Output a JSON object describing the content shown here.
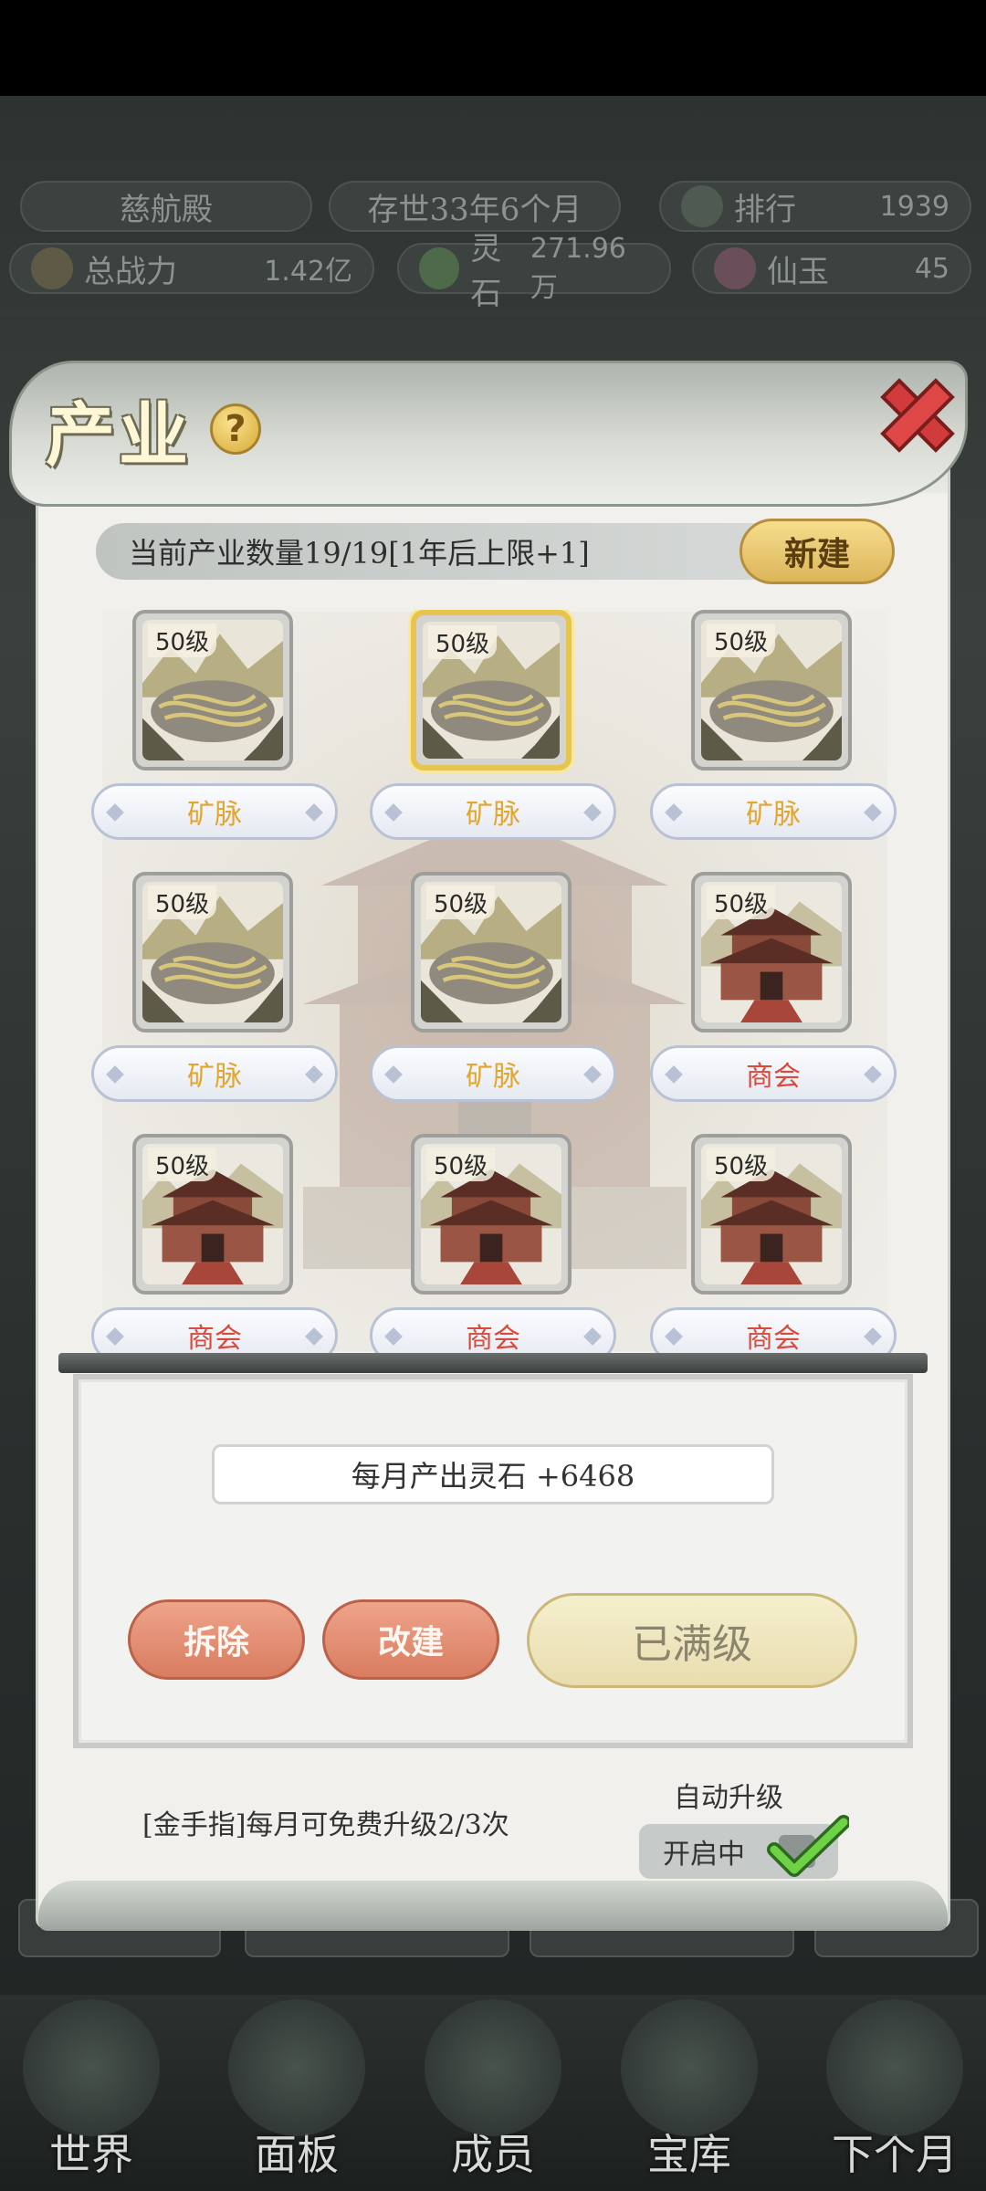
{
  "hud": {
    "sect_name": "慈航殿",
    "age": "存世33年6个月",
    "rank_label": "排行",
    "rank_value": "1939",
    "power_label": "总战力",
    "power_value": "1.42亿",
    "stone_label": "灵石",
    "stone_value": "271.96万",
    "jade_label": "仙玉",
    "jade_value": "45"
  },
  "bottom_nav": [
    {
      "label": "世界"
    },
    {
      "label": "面板"
    },
    {
      "label": "成员"
    },
    {
      "label": "宝库"
    },
    {
      "label": "下个月"
    }
  ],
  "modal": {
    "title": "产业",
    "help": "?",
    "count_text": "当前产业数量19/19[1年后上限+1]",
    "new_button": "新建",
    "slots": [
      {
        "level": "50级",
        "type": "mine",
        "label": "矿脉",
        "selected": false
      },
      {
        "level": "50级",
        "type": "mine",
        "label": "矿脉",
        "selected": true
      },
      {
        "level": "50级",
        "type": "mine",
        "label": "矿脉",
        "selected": false
      },
      {
        "level": "50级",
        "type": "mine",
        "label": "矿脉",
        "selected": false
      },
      {
        "level": "50级",
        "type": "mine",
        "label": "矿脉",
        "selected": false
      },
      {
        "level": "50级",
        "type": "shop",
        "label": "商会",
        "selected": false
      },
      {
        "level": "50级",
        "type": "shop",
        "label": "商会",
        "selected": false
      },
      {
        "level": "50级",
        "type": "shop",
        "label": "商会",
        "selected": false
      },
      {
        "level": "50级",
        "type": "shop",
        "label": "商会",
        "selected": false
      }
    ],
    "output_text": "每月产出灵石 +6468",
    "demolish_button": "拆除",
    "rebuild_button": "改建",
    "max_level_button": "已满级",
    "free_upgrade_text": "[金手指]每月可免费升级2/3次",
    "auto_upgrade_title": "自动升级",
    "auto_upgrade_state": "开启中",
    "auto_upgrade_on": true
  },
  "colors": {
    "mine_label": "#e2a52d",
    "shop_label": "#d94a3a",
    "selected_frame": "#e6c44d",
    "new_button": "#e6c466",
    "red_button": "#e48e72",
    "check": "#5fbf3a",
    "close": "#d23b3b"
  }
}
